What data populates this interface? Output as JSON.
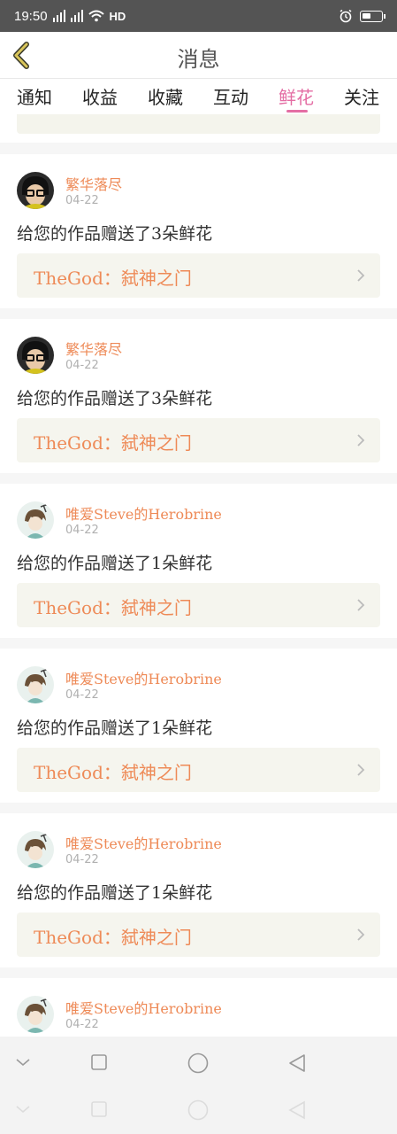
{
  "status_bar": {
    "time": "19:50",
    "net1": "4G",
    "net2": "4G",
    "hd": "HD",
    "battery_level": 0.45
  },
  "header": {
    "title": "消息"
  },
  "tabs": [
    {
      "label": "通知",
      "active": false
    },
    {
      "label": "收益",
      "active": false
    },
    {
      "label": "收藏",
      "active": false
    },
    {
      "label": "互动",
      "active": false
    },
    {
      "label": "鲜花",
      "active": true
    },
    {
      "label": "关注",
      "active": false
    }
  ],
  "messages": [
    {
      "avatar": "avatar-glasses-icon",
      "user": "繁华落尽",
      "date": "04-22",
      "text": "给您的作品赠送了3朵鲜花",
      "work": "TheGod：弑神之门"
    },
    {
      "avatar": "avatar-glasses-icon",
      "user": "繁华落尽",
      "date": "04-22",
      "text": "给您的作品赠送了3朵鲜花",
      "work": "TheGod：弑神之门"
    },
    {
      "avatar": "avatar-anime-icon",
      "user": "唯爱Steve的Herobrine",
      "date": "04-22",
      "text": "给您的作品赠送了1朵鲜花",
      "work": "TheGod：弑神之门"
    },
    {
      "avatar": "avatar-anime-icon",
      "user": "唯爱Steve的Herobrine",
      "date": "04-22",
      "text": "给您的作品赠送了1朵鲜花",
      "work": "TheGod：弑神之门"
    },
    {
      "avatar": "avatar-anime-icon",
      "user": "唯爱Steve的Herobrine",
      "date": "04-22",
      "text": "给您的作品赠送了1朵鲜花",
      "work": "TheGod：弑神之门"
    },
    {
      "avatar": "avatar-anime-icon",
      "user": "唯爱Steve的Herobrine",
      "date": "04-22",
      "text": "",
      "work": ""
    }
  ],
  "colors": {
    "accent_pink": "#e46ea4",
    "name_orange": "#ee8a57",
    "back_arrow": "#b8a23a"
  },
  "nav_icons": [
    "collapse-icon",
    "recent-apps-icon",
    "home-icon",
    "back-icon"
  ]
}
